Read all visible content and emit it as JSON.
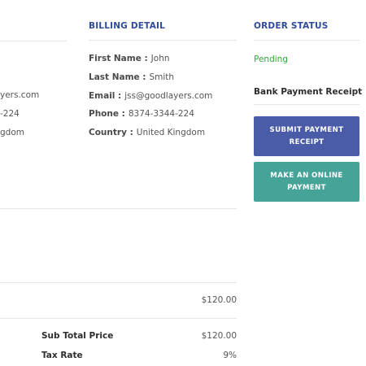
{
  "customer": {
    "email_fragment": "yers.com",
    "phone_fragment": "-224",
    "country_fragment": "gdom"
  },
  "billing": {
    "title": "BILLING DETAIL",
    "rows": [
      {
        "label": "First Name :",
        "value": "John"
      },
      {
        "label": "Last Name :",
        "value": "Smith"
      },
      {
        "label": "Email :",
        "value": "jss@goodlayers.com"
      },
      {
        "label": "Phone :",
        "value": "8374-3344-224"
      },
      {
        "label": "Country :",
        "value": "United Kingdom"
      }
    ]
  },
  "order_status": {
    "title": "ORDER STATUS",
    "value": "Pending",
    "value_color": "#2faa3a",
    "receipt_title": "Bank Payment Receipt",
    "submit_button": "SUBMIT PAYMENT RECEIPT",
    "online_button": "MAKE AN ONLINE PAYMENT",
    "submit_color": "#4a5ca7",
    "online_color": "#45a497"
  },
  "items": {
    "line_total": "$120.00"
  },
  "summary": {
    "rows": [
      {
        "label": "Sub Total Price",
        "value": "$120.00"
      },
      {
        "label": "Tax Rate",
        "value": "9%"
      }
    ]
  }
}
